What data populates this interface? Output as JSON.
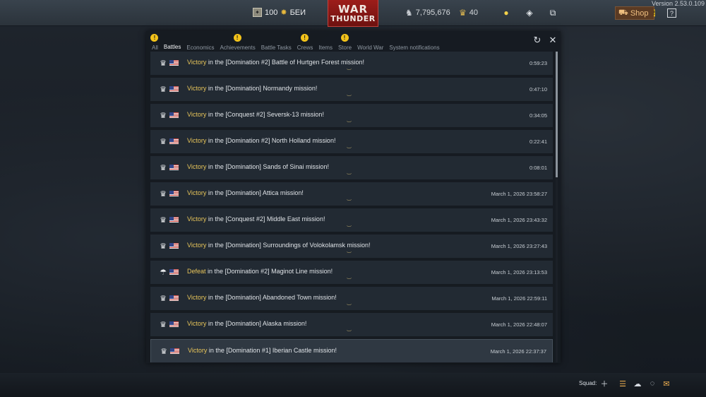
{
  "version": "Version 2.53.0.109",
  "topbar": {
    "balance_text": "100",
    "balance_suffix": "БЕИ",
    "rank_icon": "rank-badge-icon",
    "logo_line1": "WAR",
    "logo_line2": "THUNDER",
    "silver_lions": "7,795,676",
    "golden_eagles": "40",
    "shop_label": "Shop",
    "help_label": "?"
  },
  "tabs": [
    {
      "label": "All",
      "alert": true
    },
    {
      "label": "Battles",
      "alert": false,
      "active": true
    },
    {
      "label": "Economics",
      "alert": false
    },
    {
      "label": "Achievements",
      "alert": true
    },
    {
      "label": "Battle Tasks",
      "alert": false
    },
    {
      "label": "Crews",
      "alert": true
    },
    {
      "label": "Items",
      "alert": false
    },
    {
      "label": "Store",
      "alert": true
    },
    {
      "label": "World War",
      "alert": false
    },
    {
      "label": "System notifications",
      "alert": false
    }
  ],
  "battles": [
    {
      "result": "Victory",
      "text": "in the [Domination #2] Battle of Hurtgen Forest mission!",
      "time": "0:59:23",
      "icon": "trophy-icon"
    },
    {
      "result": "Victory",
      "text": "in the [Domination] Normandy mission!",
      "time": "0:47:10",
      "icon": "trophy-icon"
    },
    {
      "result": "Victory",
      "text": "in the [Conquest #2] Seversk-13 mission!",
      "time": "0:34:05",
      "icon": "trophy-icon"
    },
    {
      "result": "Victory",
      "text": "in the [Domination #2] North Holland mission!",
      "time": "0:22:41",
      "icon": "trophy-icon"
    },
    {
      "result": "Victory",
      "text": "in the [Domination] Sands of Sinai mission!",
      "time": "0:08:01",
      "icon": "trophy-icon"
    },
    {
      "result": "Victory",
      "text": "in the [Domination] Attica mission!",
      "time": "March 1, 2026 23:58:27",
      "icon": "trophy-icon"
    },
    {
      "result": "Victory",
      "text": "in the [Conquest #2] Middle East mission!",
      "time": "March 1, 2026 23:43:32",
      "icon": "trophy-icon"
    },
    {
      "result": "Victory",
      "text": "in the [Domination] Surroundings of Volokolamsk mission!",
      "time": "March 1, 2026 23:27:43",
      "icon": "trophy-icon"
    },
    {
      "result": "Defeat",
      "text": "in the [Domination #2] Maginot Line mission!",
      "time": "March 1, 2026 23:13:53",
      "icon": "parachute-icon"
    },
    {
      "result": "Victory",
      "text": "in the [Domination] Abandoned Town mission!",
      "time": "March 1, 2026 22:59:11",
      "icon": "trophy-icon"
    },
    {
      "result": "Victory",
      "text": "in the [Domination] Alaska mission!",
      "time": "March 1, 2026 22:48:07",
      "icon": "trophy-icon"
    },
    {
      "result": "Victory",
      "text": "in the [Domination #1] Iberian Castle mission!",
      "time": "March 1, 2026 22:37:37",
      "icon": "trophy-icon",
      "highlight": true
    }
  ],
  "bottombar": {
    "squad_label": "Squad:"
  },
  "colors": {
    "result_text": "#e8c55a",
    "alert": "#f2c21a",
    "logo_red": "#9d1d1a"
  }
}
